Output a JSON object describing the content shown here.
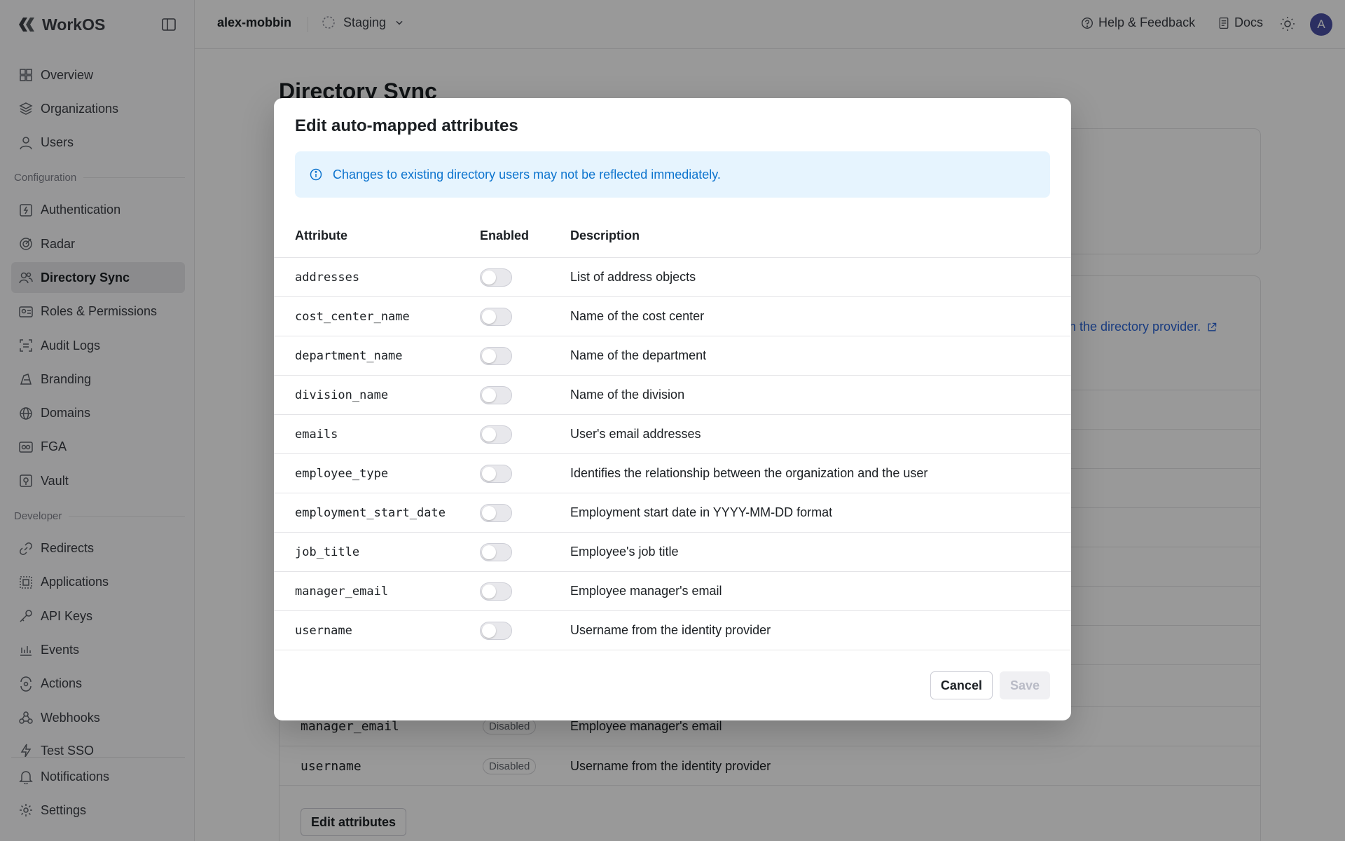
{
  "app": {
    "brand": "WorkOS",
    "org_name": "alex-mobbin",
    "environment": "Staging",
    "help_label": "Help & Feedback",
    "docs_label": "Docs",
    "avatar_initial": "A"
  },
  "sidebar": {
    "items": [
      {
        "label": "Overview"
      },
      {
        "label": "Organizations"
      },
      {
        "label": "Users"
      }
    ],
    "section_config": "Configuration",
    "config_items": [
      {
        "label": "Authentication"
      },
      {
        "label": "Radar"
      },
      {
        "label": "Directory Sync"
      },
      {
        "label": "Roles & Permissions"
      },
      {
        "label": "Audit Logs"
      },
      {
        "label": "Branding"
      },
      {
        "label": "Domains"
      },
      {
        "label": "FGA"
      },
      {
        "label": "Vault"
      }
    ],
    "section_dev": "Developer",
    "dev_items": [
      {
        "label": "Redirects"
      },
      {
        "label": "Applications"
      },
      {
        "label": "API Keys"
      },
      {
        "label": "Events"
      },
      {
        "label": "Actions"
      },
      {
        "label": "Webhooks"
      },
      {
        "label": "Test SSO"
      }
    ],
    "bottom_items": [
      {
        "label": "Notifications"
      },
      {
        "label": "Settings"
      }
    ]
  },
  "page": {
    "title": "Directory Sync",
    "link_text": "n the directory provider.",
    "bg_rows": [
      {
        "attr": "manager_email",
        "status": "Disabled",
        "desc": "Employee manager's email"
      },
      {
        "attr": "username",
        "status": "Disabled",
        "desc": "Username from the identity provider"
      }
    ],
    "edit_button": "Edit attributes"
  },
  "modal": {
    "title": "Edit auto-mapped attributes",
    "callout": "Changes to existing directory users may not be reflected immediately.",
    "columns": {
      "attribute": "Attribute",
      "enabled": "Enabled",
      "description": "Description"
    },
    "rows": [
      {
        "attr": "addresses",
        "enabled": false,
        "desc": "List of address objects"
      },
      {
        "attr": "cost_center_name",
        "enabled": false,
        "desc": "Name of the cost center"
      },
      {
        "attr": "department_name",
        "enabled": false,
        "desc": "Name of the department"
      },
      {
        "attr": "division_name",
        "enabled": false,
        "desc": "Name of the division"
      },
      {
        "attr": "emails",
        "enabled": false,
        "desc": "User's email addresses"
      },
      {
        "attr": "employee_type",
        "enabled": false,
        "desc": "Identifies the relationship between the organization and the user"
      },
      {
        "attr": "employment_start_date",
        "enabled": false,
        "desc": "Employment start date in YYYY-MM-DD format"
      },
      {
        "attr": "job_title",
        "enabled": false,
        "desc": "Employee's job title"
      },
      {
        "attr": "manager_email",
        "enabled": false,
        "desc": "Employee manager's email"
      },
      {
        "attr": "username",
        "enabled": false,
        "desc": "Username from the identity provider"
      }
    ],
    "cancel_label": "Cancel",
    "save_label": "Save"
  },
  "colors": {
    "overlay": "#000000",
    "callout_bg": "#e6f4fe",
    "callout_text": "#0d74ce",
    "avatar": "#4a4fa3",
    "link": "#2b64d6"
  }
}
